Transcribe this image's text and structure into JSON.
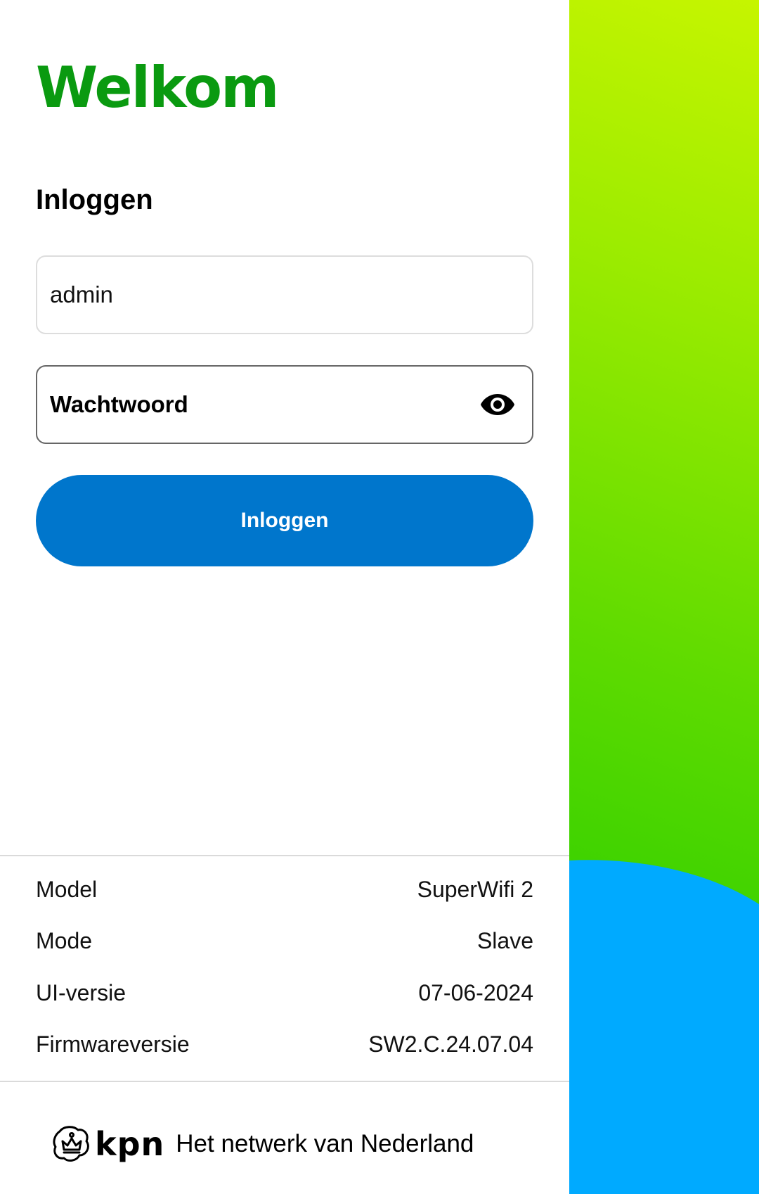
{
  "header": {
    "title": "Welkom",
    "title_color": "#0a9a10"
  },
  "login": {
    "heading": "Inloggen",
    "username_value": "admin",
    "password_placeholder": "Wachtwoord",
    "show_password_icon": "eye-icon",
    "button_label": "Inloggen",
    "button_color": "#0076cc"
  },
  "info": {
    "rows": [
      {
        "label": "Model",
        "value": "SuperWifi 2"
      },
      {
        "label": "Mode",
        "value": "Slave"
      },
      {
        "label": "UI-versie",
        "value": "07-06-2024"
      },
      {
        "label": "Firmwareversie",
        "value": "SW2.C.24.07.04"
      }
    ]
  },
  "footer": {
    "logo_icon": "kpn-crown-icon",
    "brand": "kpn",
    "tagline": "Het netwerk van Nederland"
  },
  "side": {
    "gradient_top": "#c6f500",
    "gradient_bottom": "#2cc900",
    "blue": "#00aaff"
  }
}
